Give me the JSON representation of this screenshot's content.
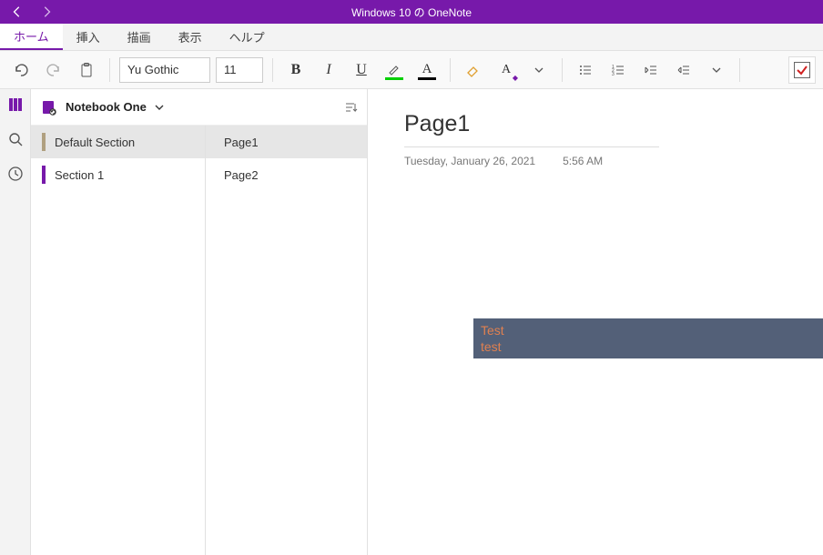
{
  "titlebar": {
    "title": "Windows 10 の OneNote"
  },
  "menu": {
    "home": "ホーム",
    "insert": "挿入",
    "draw": "描画",
    "view": "表示",
    "help": "ヘルプ"
  },
  "toolbar": {
    "font_name": "Yu Gothic",
    "font_size": "11"
  },
  "notebook": {
    "name": "Notebook One"
  },
  "sections": [
    {
      "label": "Default Section",
      "selected": true
    },
    {
      "label": "Section 1",
      "selected": false
    }
  ],
  "pages": [
    {
      "label": "Page1",
      "selected": true
    },
    {
      "label": "Page2",
      "selected": false
    }
  ],
  "content": {
    "title": "Page1",
    "date": "Tuesday, January 26, 2021",
    "time": "5:56 AM",
    "block_line1": "Test",
    "block_line2": "test"
  }
}
